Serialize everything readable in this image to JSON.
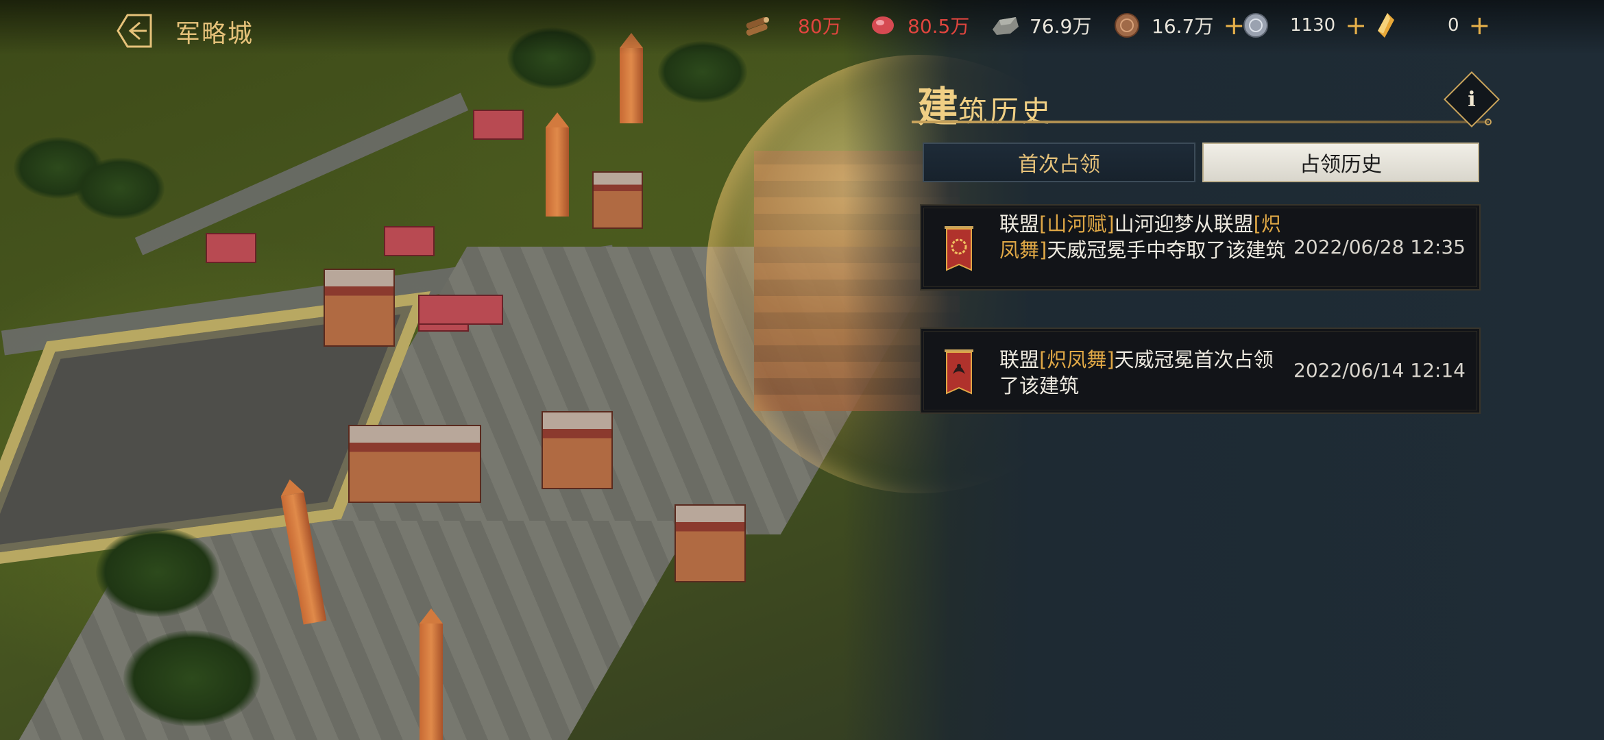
{
  "topbar": {
    "back_icon": "back-arrow-icon",
    "city_title": "军略城",
    "resources": [
      {
        "icon": "wood-icon",
        "value": "80万",
        "color": "#e0453e",
        "has_plus": false
      },
      {
        "icon": "meat-icon",
        "value": "80.5万",
        "color": "#e0453e",
        "has_plus": false
      },
      {
        "icon": "stone-icon",
        "value": "76.9万",
        "color": "#e8e4da",
        "has_plus": false
      },
      {
        "icon": "copper-coin-icon",
        "value": "16.7万",
        "color": "#e8e4da",
        "has_plus": true
      },
      {
        "icon": "silver-coin-icon",
        "value": "1130",
        "color": "#e8e4da",
        "has_plus": true
      },
      {
        "icon": "gold-crystal-icon",
        "value": "0",
        "color": "#e8e4da",
        "has_plus": true
      }
    ],
    "plus": "+"
  },
  "panel": {
    "title_big": "建",
    "title_rest": "筑历史",
    "info_label": "i",
    "tabs": [
      {
        "label": "首次占领",
        "selected": false
      },
      {
        "label": "占领历史",
        "selected": true
      }
    ],
    "records": [
      {
        "icon": "alliance-banner-wreath-icon",
        "p1": "联盟",
        "a1": "[山河赋]",
        "p2": "山河迎梦从联盟",
        "a2": "[炽凤舞]",
        "p3": "天威冠冕手中夺取了该建筑",
        "time": "2022/06/28 12:35"
      },
      {
        "icon": "alliance-banner-phoenix-icon",
        "p1": "联盟",
        "a1": "[炽凤舞]",
        "p2": "天威冠冕首次占领了该建筑",
        "time": "2022/06/14 12:14"
      }
    ],
    "accent_color": "#e0a846"
  }
}
